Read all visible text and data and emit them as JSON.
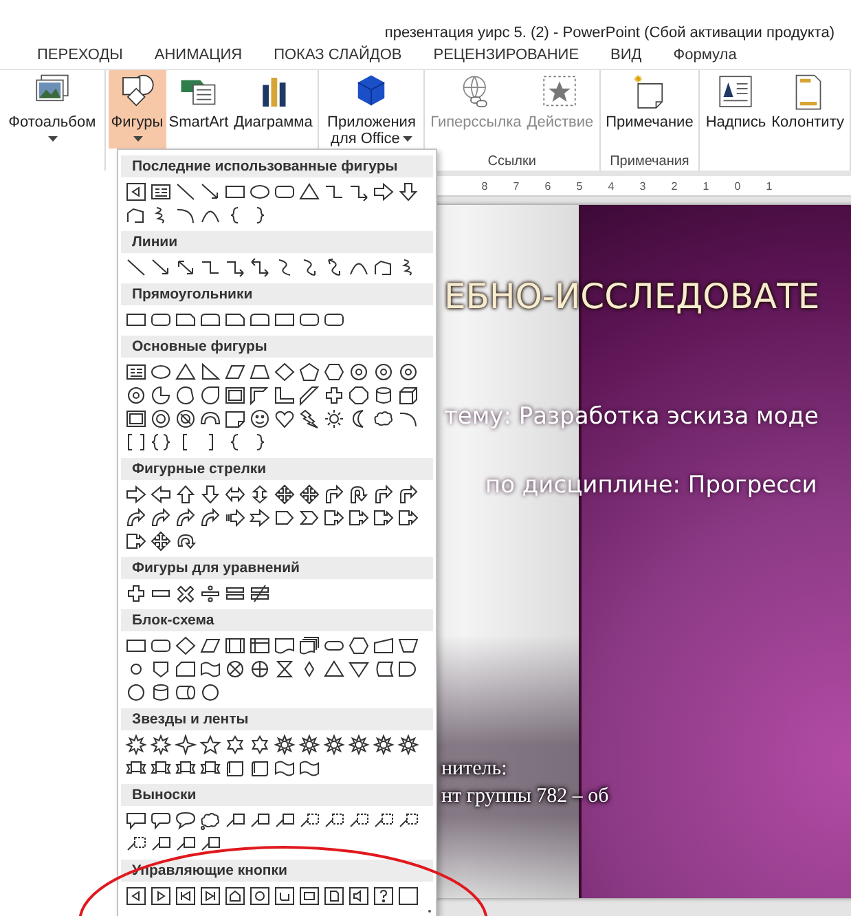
{
  "window": {
    "title": "презентация уирс 5. (2) - PowerPoint (Сбой активации продукта)"
  },
  "tabs": [
    {
      "label": "ПЕРЕХОДЫ"
    },
    {
      "label": "АНИМАЦИЯ"
    },
    {
      "label": "ПОКАЗ СЛАЙДОВ"
    },
    {
      "label": "РЕЦЕНЗИРОВАНИЕ"
    },
    {
      "label": "ВИД"
    },
    {
      "label": "Формула"
    }
  ],
  "ribbon": {
    "groups": [
      {
        "items": [
          {
            "label": "Фотоальбом",
            "kind": "photo-album",
            "dropdown": true,
            "selected": false,
            "disabled": false
          }
        ]
      },
      {
        "items": [
          {
            "label": "Фигуры",
            "kind": "shapes",
            "dropdown": true,
            "selected": true,
            "disabled": false
          },
          {
            "label": "SmartArt",
            "kind": "smartart",
            "dropdown": false,
            "selected": false,
            "disabled": false
          },
          {
            "label": "Диаграмма",
            "kind": "chart",
            "dropdown": false,
            "selected": false,
            "disabled": false
          }
        ]
      },
      {
        "items": [
          {
            "label": "Приложения для Office",
            "kind": "office-apps",
            "dropdown": true,
            "selected": false,
            "disabled": false
          }
        ]
      },
      {
        "label": "Ссылки",
        "items": [
          {
            "label": "Гиперссылка",
            "kind": "hyperlink",
            "dropdown": false,
            "selected": false,
            "disabled": true
          },
          {
            "label": "Действие",
            "kind": "action",
            "dropdown": false,
            "selected": false,
            "disabled": true
          }
        ]
      },
      {
        "label": "Примечания",
        "items": [
          {
            "label": "Примечание",
            "kind": "comment",
            "dropdown": false,
            "selected": false,
            "disabled": false
          }
        ]
      },
      {
        "items": [
          {
            "label": "Надпись",
            "kind": "text-box",
            "dropdown": false,
            "selected": false,
            "disabled": false
          },
          {
            "label": "Колонтиту",
            "kind": "header-footer",
            "dropdown": false,
            "selected": false,
            "disabled": false
          }
        ]
      }
    ]
  },
  "shapes_gallery": {
    "sections": [
      {
        "title": "Последние использованные фигуры",
        "shapes": [
          {
            "kind": "action-button-back"
          },
          {
            "kind": "text-box"
          },
          {
            "kind": "line"
          },
          {
            "kind": "arrow-line"
          },
          {
            "kind": "rectangle"
          },
          {
            "kind": "oval"
          },
          {
            "kind": "rounded-rectangle"
          },
          {
            "kind": "triangle"
          },
          {
            "kind": "elbow-connector"
          },
          {
            "kind": "elbow-arrow"
          },
          {
            "kind": "arrow-right"
          },
          {
            "kind": "arrow-down"
          },
          {
            "kind": "freeform"
          },
          {
            "kind": "scribble"
          },
          {
            "kind": "arc"
          },
          {
            "kind": "curve"
          },
          {
            "kind": "brace-left"
          },
          {
            "kind": "brace-right"
          }
        ]
      },
      {
        "title": "Линии",
        "shapes": [
          {
            "kind": "line"
          },
          {
            "kind": "arrow-line"
          },
          {
            "kind": "double-arrow-line"
          },
          {
            "kind": "elbow-connector"
          },
          {
            "kind": "elbow-arrow"
          },
          {
            "kind": "elbow-double-arrow"
          },
          {
            "kind": "s-curve"
          },
          {
            "kind": "s-curve-arrow"
          },
          {
            "kind": "s-curve-double-arrow"
          },
          {
            "kind": "curve"
          },
          {
            "kind": "freeform"
          },
          {
            "kind": "scribble"
          }
        ]
      },
      {
        "title": "Прямоугольники",
        "shapes": [
          {
            "kind": "rectangle"
          },
          {
            "kind": "rounded-rectangle"
          },
          {
            "kind": "snip-rectangle"
          },
          {
            "kind": "round-top-rectangle"
          },
          {
            "kind": "snip-rectangle"
          },
          {
            "kind": "round-top-rectangle"
          },
          {
            "kind": "rectangle"
          },
          {
            "kind": "rounded-rectangle"
          },
          {
            "kind": "rounded-rectangle"
          }
        ]
      },
      {
        "title": "Основные фигуры",
        "shapes": [
          {
            "kind": "text-box"
          },
          {
            "kind": "oval"
          },
          {
            "kind": "triangle"
          },
          {
            "kind": "right-triangle"
          },
          {
            "kind": "parallelogram"
          },
          {
            "kind": "trapezoid"
          },
          {
            "kind": "diamond"
          },
          {
            "kind": "pentagon"
          },
          {
            "kind": "hexagon"
          },
          {
            "kind": "numbered-circle"
          },
          {
            "kind": "numbered-circle"
          },
          {
            "kind": "numbered-circle"
          },
          {
            "kind": "numbered-circle"
          },
          {
            "kind": "pie"
          },
          {
            "kind": "chord"
          },
          {
            "kind": "teardrop"
          },
          {
            "kind": "frame"
          },
          {
            "kind": "half-frame"
          },
          {
            "kind": "l-shape"
          },
          {
            "kind": "diagonal-stripe"
          },
          {
            "kind": "plus"
          },
          {
            "kind": "octagon"
          },
          {
            "kind": "cylinder"
          },
          {
            "kind": "cube"
          },
          {
            "kind": "frame"
          },
          {
            "kind": "donut"
          },
          {
            "kind": "no-symbol"
          },
          {
            "kind": "block-arc"
          },
          {
            "kind": "folded-corner"
          },
          {
            "kind": "smiley"
          },
          {
            "kind": "heart"
          },
          {
            "kind": "lightning"
          },
          {
            "kind": "sun"
          },
          {
            "kind": "moon"
          },
          {
            "kind": "cloud"
          },
          {
            "kind": "arc"
          },
          {
            "kind": "bracket-pair"
          },
          {
            "kind": "brace-pair"
          },
          {
            "kind": "bracket-left"
          },
          {
            "kind": "bracket-right"
          },
          {
            "kind": "brace-left"
          },
          {
            "kind": "brace-right"
          }
        ]
      },
      {
        "title": "Фигурные стрелки",
        "shapes": [
          {
            "kind": "arrow-right"
          },
          {
            "kind": "arrow-left"
          },
          {
            "kind": "arrow-up"
          },
          {
            "kind": "arrow-down"
          },
          {
            "kind": "double-arrow"
          },
          {
            "kind": "double-arrow-vertical"
          },
          {
            "kind": "quad-arrow"
          },
          {
            "kind": "quad-arrow"
          },
          {
            "kind": "bent-arrow"
          },
          {
            "kind": "u-turn-arrow"
          },
          {
            "kind": "bent-arrow"
          },
          {
            "kind": "bent-arrow"
          },
          {
            "kind": "curved-arrow"
          },
          {
            "kind": "curved-arrow"
          },
          {
            "kind": "curved-arrow"
          },
          {
            "kind": "curved-arrow"
          },
          {
            "kind": "striped-arrow"
          },
          {
            "kind": "notched-arrow"
          },
          {
            "kind": "pentagon-arrow"
          },
          {
            "kind": "chevron"
          },
          {
            "kind": "callout-arrow"
          },
          {
            "kind": "callout-arrow"
          },
          {
            "kind": "callout-arrow"
          },
          {
            "kind": "callout-arrow"
          },
          {
            "kind": "callout-arrow"
          },
          {
            "kind": "quad-arrow"
          },
          {
            "kind": "circular-arrow"
          }
        ]
      },
      {
        "title": "Фигуры для уравнений",
        "shapes": [
          {
            "kind": "plus"
          },
          {
            "kind": "minus"
          },
          {
            "kind": "multiply"
          },
          {
            "kind": "divide"
          },
          {
            "kind": "equal"
          },
          {
            "kind": "not-equal"
          }
        ]
      },
      {
        "title": "Блок-схема",
        "shapes": [
          {
            "kind": "rectangle"
          },
          {
            "kind": "rounded-rectangle"
          },
          {
            "kind": "diamond"
          },
          {
            "kind": "parallelogram"
          },
          {
            "kind": "predefined-process"
          },
          {
            "kind": "internal-storage"
          },
          {
            "kind": "document"
          },
          {
            "kind": "multi-document"
          },
          {
            "kind": "terminator"
          },
          {
            "kind": "hexagon"
          },
          {
            "kind": "manual-input"
          },
          {
            "kind": "inverted-trapezoid"
          },
          {
            "kind": "small-circle"
          },
          {
            "kind": "offpage"
          },
          {
            "kind": "card"
          },
          {
            "kind": "wave"
          },
          {
            "kind": "cross-circle"
          },
          {
            "kind": "plus-circle"
          },
          {
            "kind": "hourglass"
          },
          {
            "kind": "small-diamond"
          },
          {
            "kind": "triangle"
          },
          {
            "kind": "triangle-down"
          },
          {
            "kind": "stored-data"
          },
          {
            "kind": "delay"
          },
          {
            "kind": "circle"
          },
          {
            "kind": "cylinder"
          },
          {
            "kind": "horizontal-cylinder"
          },
          {
            "kind": "circle"
          }
        ]
      },
      {
        "title": "Звезды и ленты",
        "shapes": [
          {
            "kind": "burst"
          },
          {
            "kind": "burst"
          },
          {
            "kind": "star4"
          },
          {
            "kind": "star"
          },
          {
            "kind": "star6"
          },
          {
            "kind": "star6"
          },
          {
            "kind": "seal"
          },
          {
            "kind": "seal"
          },
          {
            "kind": "seal"
          },
          {
            "kind": "seal"
          },
          {
            "kind": "seal"
          },
          {
            "kind": "seal"
          },
          {
            "kind": "ribbon"
          },
          {
            "kind": "ribbon"
          },
          {
            "kind": "ribbon"
          },
          {
            "kind": "ribbon"
          },
          {
            "kind": "scroll"
          },
          {
            "kind": "scroll"
          },
          {
            "kind": "wave"
          },
          {
            "kind": "wave"
          }
        ]
      },
      {
        "title": "Выноски",
        "shapes": [
          {
            "kind": "callout"
          },
          {
            "kind": "rounded-callout"
          },
          {
            "kind": "oval-callout"
          },
          {
            "kind": "cloud-callout"
          },
          {
            "kind": "line-callout"
          },
          {
            "kind": "line-callout"
          },
          {
            "kind": "line-callout"
          },
          {
            "kind": "dashed-line-callout"
          },
          {
            "kind": "dashed-line-callout"
          },
          {
            "kind": "dashed-line-callout"
          },
          {
            "kind": "dashed-line-callout"
          },
          {
            "kind": "dashed-line-callout"
          },
          {
            "kind": "dashed-line-callout"
          },
          {
            "kind": "line-callout"
          },
          {
            "kind": "line-callout"
          },
          {
            "kind": "line-callout"
          }
        ]
      },
      {
        "title": "Управляющие кнопки",
        "shapes": [
          {
            "kind": "action-button-back"
          },
          {
            "kind": "action-button-forward"
          },
          {
            "kind": "action-button-beginning"
          },
          {
            "kind": "action-button-end"
          },
          {
            "kind": "action-button-home"
          },
          {
            "kind": "action-button-info"
          },
          {
            "kind": "action-button-return"
          },
          {
            "kind": "action-button-movie"
          },
          {
            "kind": "action-button-document"
          },
          {
            "kind": "action-button-sound"
          },
          {
            "kind": "action-button-help"
          },
          {
            "kind": "action-button-blank"
          }
        ]
      }
    ]
  },
  "ruler": {
    "labels": [
      "8",
      "7",
      "6",
      "5",
      "4",
      "3",
      "2",
      "1",
      "0",
      "1"
    ]
  },
  "slide": {
    "texts": [
      {
        "text": "ЕБНО-ИССЛЕДОВАТЕ",
        "kind": "title"
      },
      {
        "text": "тему: Разработка эскиза моде",
        "kind": "subtitle"
      },
      {
        "text": "по дисциплине: Прогресси",
        "kind": "subtitle-indented"
      },
      {
        "text": "нитель:",
        "kind": "body"
      },
      {
        "text": "нт группы 782 – об",
        "kind": "body-second"
      }
    ]
  }
}
